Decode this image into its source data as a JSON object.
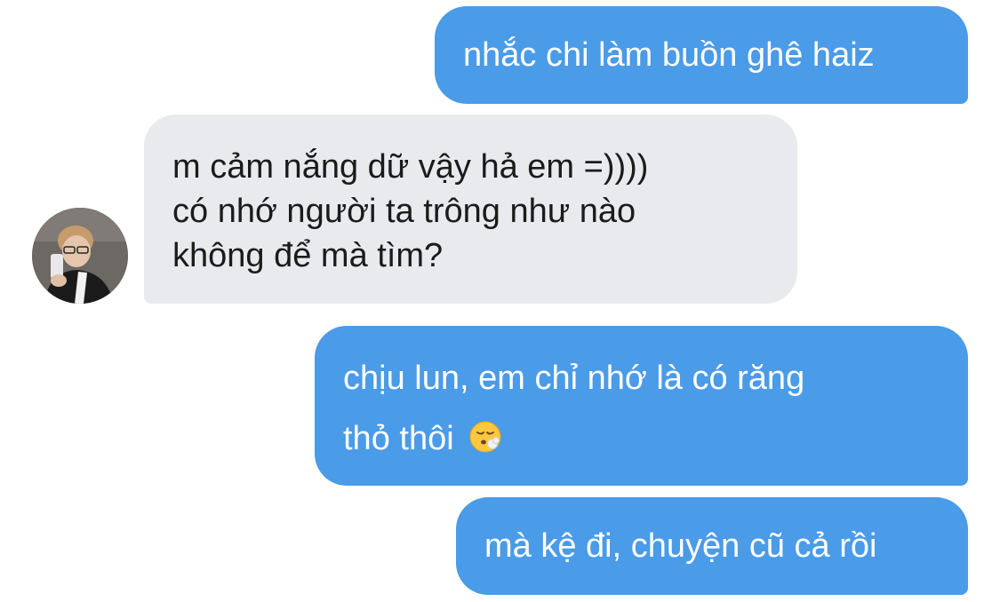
{
  "conversation": {
    "messages": [
      {
        "direction": "sent",
        "lines": [
          "nhắc chi làm buồn ghê haiz"
        ]
      },
      {
        "direction": "received",
        "lines": [
          "m cảm nắng dữ vậy hả em =))))",
          "có nhớ người ta trông như nào",
          "không để mà tìm?"
        ]
      },
      {
        "direction": "sent",
        "lines": [
          "chịu lun, em chỉ nhớ là có răng",
          "thỏ thôi"
        ],
        "emoji": "face-exhaling-icon"
      },
      {
        "direction": "sent",
        "lines": [
          "mà kệ đi, chuyện cũ cả rồi"
        ]
      }
    ],
    "contact": {
      "avatar": "contact-avatar"
    }
  },
  "colors": {
    "sent_bubble": "#4a9be8",
    "received_bubble": "#e9eaee",
    "sent_text": "#ffffff",
    "received_text": "#1b1b1b"
  }
}
